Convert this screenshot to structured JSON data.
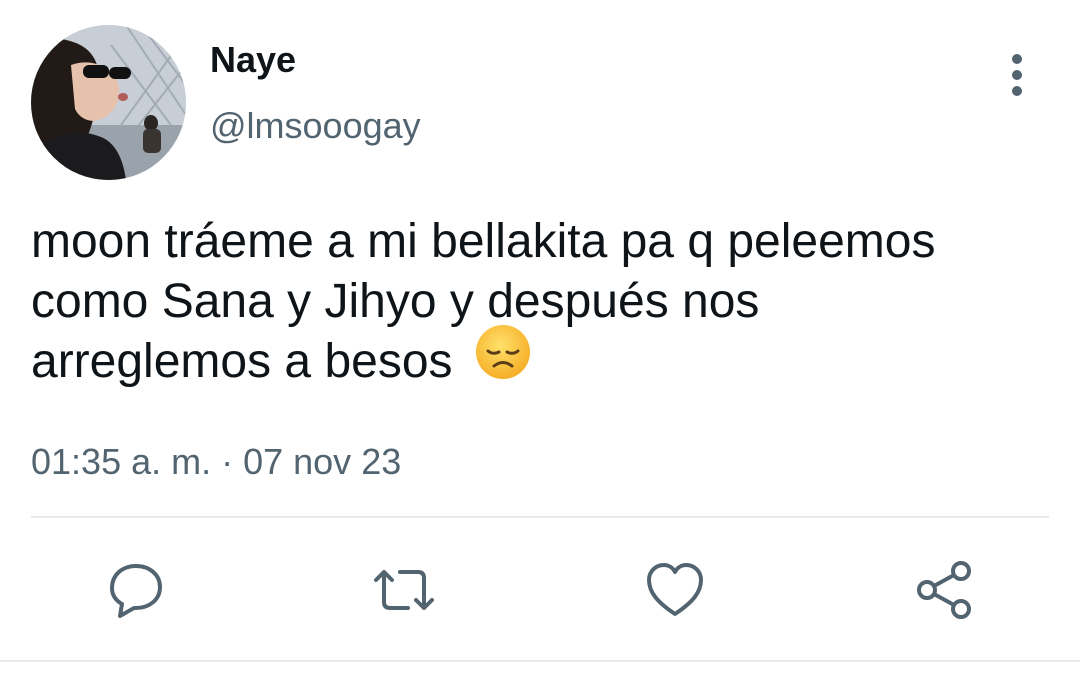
{
  "user": {
    "display_name": "Naye",
    "handle": "@lmsooogay",
    "avatar_icon": "user-avatar-photo"
  },
  "tweet": {
    "lines": [
      "moon tráeme a mi bellakita pa q peleemos",
      "como Sana y Jihyo y después nos",
      "arreglemos a besos"
    ],
    "emoji": "😞",
    "timestamp": "01:35 a. m. · 07 nov 23"
  },
  "actions": [
    {
      "name": "reply",
      "icon": "reply-icon"
    },
    {
      "name": "retweet",
      "icon": "retweet-icon"
    },
    {
      "name": "like",
      "icon": "heart-icon"
    },
    {
      "name": "share",
      "icon": "share-icon"
    }
  ],
  "colors": {
    "text": "#0f1419",
    "secondary": "#536471",
    "icon": "#536471",
    "divider": "#e6ebee",
    "emoji_face": "#fbc43a"
  }
}
